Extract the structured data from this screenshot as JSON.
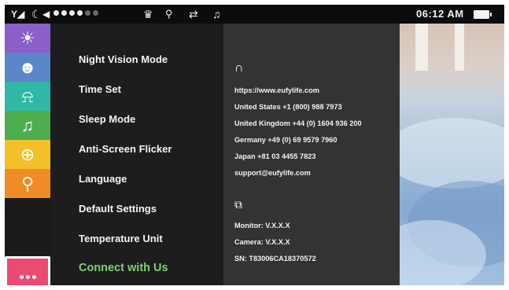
{
  "status_bar": {
    "time": "06:12 AM",
    "icons": [
      "signal-icon",
      "moon-icon",
      "speaker-icon",
      "volume-dots",
      "lullaby-light-icon",
      "camera-temp-icon",
      "loop-icon",
      "music-note-icon",
      "battery-icon"
    ]
  },
  "sidebar": {
    "items": [
      {
        "name": "brightness",
        "color": "#8a5fc8",
        "icon": "brightness-icon"
      },
      {
        "name": "baby-face",
        "color": "#5b86c9",
        "icon": "baby-icon"
      },
      {
        "name": "alarm",
        "color": "#2fb8a5",
        "icon": "alarm-light-icon"
      },
      {
        "name": "lullaby",
        "color": "#4cae4c",
        "icon": "lullaby-icon"
      },
      {
        "name": "zoom",
        "color": "#f3c02a",
        "icon": "zoom-icon"
      },
      {
        "name": "temperature",
        "color": "#f08c24",
        "icon": "thermometer-icon"
      },
      {
        "name": "more",
        "color": "#ec4a73",
        "icon": "more-icon"
      }
    ]
  },
  "menu": {
    "items": [
      "Night Vision Mode",
      "Time Set",
      "Sleep Mode",
      "Anti-Screen Flicker",
      "Language",
      "Default Settings",
      "Temperature Unit",
      "Connect with Us"
    ],
    "selected_index": 7,
    "selected_color": "#7bd36b"
  },
  "info": {
    "contact_icon": "headset-icon",
    "contact_lines": [
      "https://www.eufylife.com",
      "United States +1 (800) 988 7973",
      "United Kingdom +44 (0) 1604 936 200",
      "Germany +49 (0) 69 9579 7960",
      "Japan +81 03 4455 7823",
      "support@eufylife.com"
    ],
    "version_icon": "device-info-icon",
    "version_lines": [
      "Monitor: V.X.X.X",
      "Camera: V.X.X.X",
      "SN: T83006CA18370572"
    ]
  }
}
